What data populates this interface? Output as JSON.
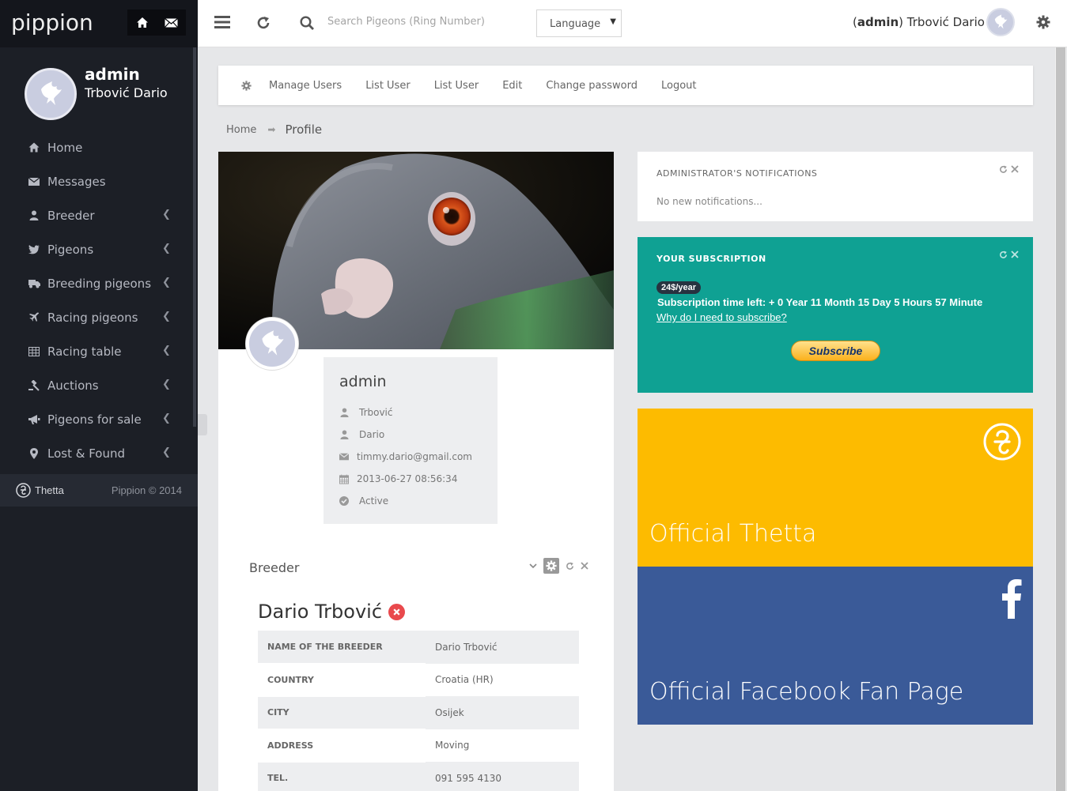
{
  "app": {
    "logo": "pippion"
  },
  "sidebar": {
    "user": {
      "username": "admin",
      "full_name": "Trbović Dario"
    },
    "items": [
      {
        "label": "Home",
        "icon": "home-icon",
        "chevron": false
      },
      {
        "label": "Messages",
        "icon": "envelope-icon",
        "chevron": false
      },
      {
        "label": "Breeder",
        "icon": "user-icon",
        "chevron": true
      },
      {
        "label": "Pigeons",
        "icon": "twitter-bird-icon",
        "chevron": true
      },
      {
        "label": "Breeding pigeons",
        "icon": "truck-icon",
        "chevron": true
      },
      {
        "label": "Racing pigeons",
        "icon": "plane-icon",
        "chevron": true
      },
      {
        "label": "Racing table",
        "icon": "table-icon",
        "chevron": true
      },
      {
        "label": "Auctions",
        "icon": "gavel-icon",
        "chevron": true
      },
      {
        "label": "Pigeons for sale",
        "icon": "bullhorn-icon",
        "chevron": true
      },
      {
        "label": "Lost & Found",
        "icon": "map-marker-icon",
        "chevron": true
      }
    ],
    "footer": {
      "brand": "Thetta",
      "copyright": "Pippion © 2014"
    }
  },
  "topbar": {
    "search_placeholder": "Search Pigeons (Ring Number)",
    "language_label": "Language",
    "user_role": "admin",
    "user_name": "Trbović Dario"
  },
  "subnav": {
    "items": [
      "Manage Users",
      "List User",
      "List User",
      "Edit",
      "Change password",
      "Logout"
    ]
  },
  "breadcrumb": {
    "home": "Home",
    "current": "Profile"
  },
  "profile": {
    "username": "admin",
    "last_name": "Trbović",
    "first_name": "Dario",
    "email": "timmy.dario@gmail.com",
    "date": "2013-06-27 08:56:34",
    "status": "Active"
  },
  "breeder": {
    "panel_title": "Breeder",
    "name": "Dario Trbović",
    "rows": [
      {
        "key": "NAME OF THE BREEDER",
        "value": "Dario Trbović"
      },
      {
        "key": "COUNTRY",
        "value": "Croatia (HR)"
      },
      {
        "key": "CITY",
        "value": "Osijek"
      },
      {
        "key": "ADDRESS",
        "value": "Moving"
      },
      {
        "key": "TEL.",
        "value": "091 595 4130"
      }
    ]
  },
  "notifications": {
    "title": "ADMINISTRATOR'S NOTIFICATIONS",
    "message": "No new notifications..."
  },
  "subscription": {
    "title": "YOUR SUBSCRIPTION",
    "price_badge": "24$/year",
    "time_left": "Subscription time left: + 0 Year 11 Month 15 Day 5 Hours 57 Minute",
    "why_link": "Why do I need to subscribe?",
    "button": "Subscribe"
  },
  "tiles": [
    {
      "label": "Official Thetta",
      "color": "#fdbb00"
    },
    {
      "label": "Official Facebook Fan Page",
      "color": "#3a5a98"
    }
  ],
  "colors": {
    "sidebar": "#1c1f26",
    "subscription": "#0fa193",
    "accent_red": "#e9494d"
  }
}
